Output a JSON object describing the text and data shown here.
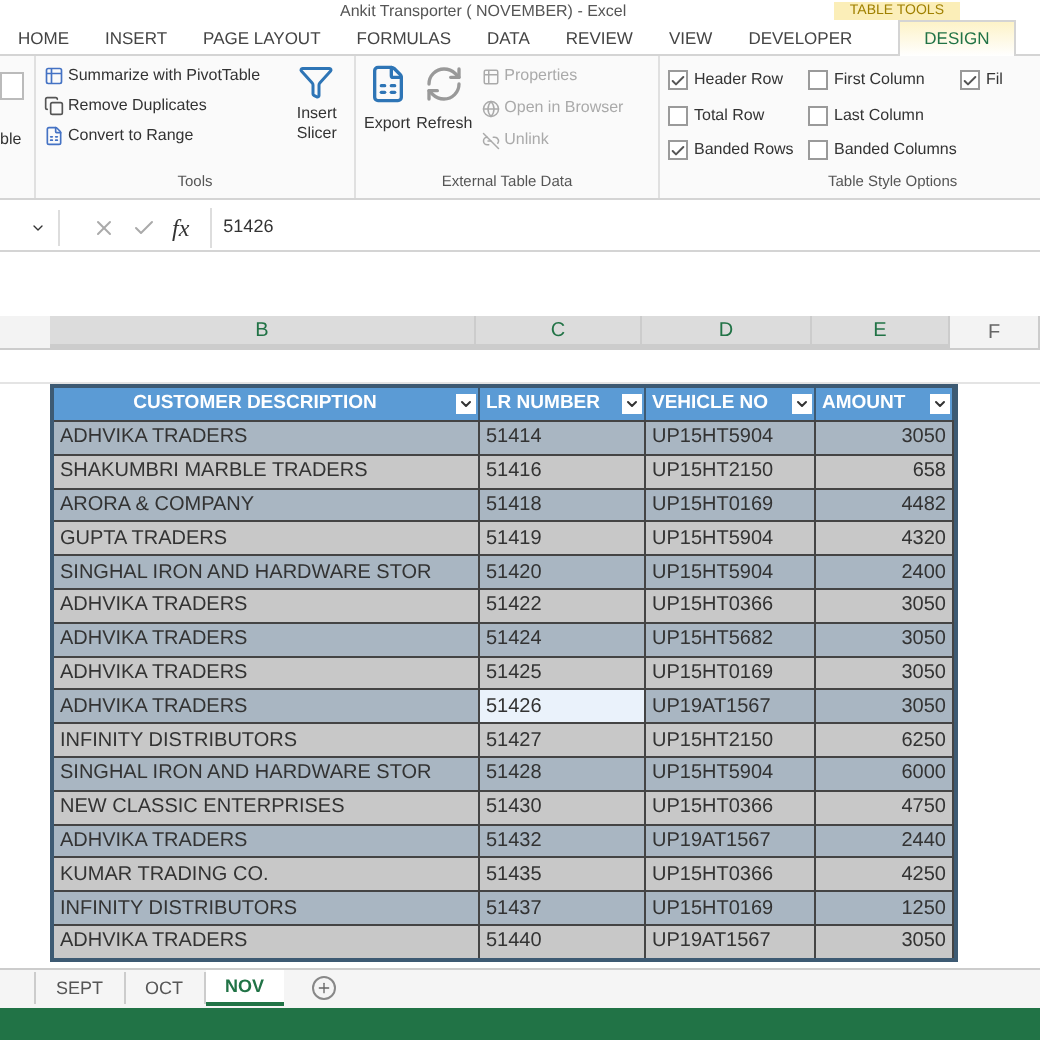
{
  "window": {
    "title": "Ankit Transporter ( NOVEMBER) - Excel",
    "context_tab": "TABLE TOOLS"
  },
  "ribbon_tabs": [
    {
      "label": "HOME",
      "selected": false
    },
    {
      "label": "INSERT",
      "selected": false
    },
    {
      "label": "PAGE LAYOUT",
      "selected": false
    },
    {
      "label": "FORMULAS",
      "selected": false
    },
    {
      "label": "DATA",
      "selected": false
    },
    {
      "label": "REVIEW",
      "selected": false
    },
    {
      "label": "VIEW",
      "selected": false
    },
    {
      "label": "DEVELOPER",
      "selected": false
    },
    {
      "label": "DESIGN",
      "selected": true
    }
  ],
  "properties_group": {
    "cut_label": "ble"
  },
  "tools_group": {
    "commands": [
      "Summarize with PivotTable",
      "Remove Duplicates",
      "Convert to Range"
    ],
    "slicer_button": "Insert Slicer",
    "label": "Tools"
  },
  "external_group": {
    "export": "Export",
    "refresh": "Refresh",
    "commands": [
      {
        "label": "Properties",
        "disabled": true
      },
      {
        "label": "Open in Browser",
        "disabled": true
      },
      {
        "label": "Unlink",
        "disabled": true
      }
    ],
    "label": "External Table Data"
  },
  "style_options": {
    "options": [
      {
        "label": "Header Row",
        "checked": true
      },
      {
        "label": "Total Row",
        "checked": false
      },
      {
        "label": "Banded Rows",
        "checked": true
      },
      {
        "label": "First Column",
        "checked": false
      },
      {
        "label": "Last Column",
        "checked": false
      },
      {
        "label": "Banded Columns",
        "checked": false
      },
      {
        "label": "Fil",
        "checked": true
      }
    ],
    "label": "Table Style Options"
  },
  "formula_bar": {
    "fx": "fx",
    "value": "51426"
  },
  "column_headers": [
    "B",
    "C",
    "D",
    "E",
    "F"
  ],
  "table": {
    "columns": [
      "CUSTOMER DESCRIPTION",
      "LR NUMBER",
      "VEHICLE NO",
      "AMOUNT"
    ],
    "rows": [
      {
        "cells": [
          "ADHVIKA TRADERS",
          "51414",
          "UP15HT5904",
          "3050"
        ],
        "selected": false
      },
      {
        "cells": [
          "SHAKUMBRI MARBLE TRADERS",
          "51416",
          "UP15HT2150",
          "658"
        ],
        "selected": false
      },
      {
        "cells": [
          "ARORA & COMPANY",
          "51418",
          "UP15HT0169",
          "4482"
        ],
        "selected": false
      },
      {
        "cells": [
          "GUPTA TRADERS",
          "51419",
          "UP15HT5904",
          "4320"
        ],
        "selected": false
      },
      {
        "cells": [
          "SINGHAL IRON AND HARDWARE STOR",
          "51420",
          "UP15HT5904",
          "2400"
        ],
        "selected": false
      },
      {
        "cells": [
          "ADHVIKA TRADERS",
          "51422",
          "UP15HT0366",
          "3050"
        ],
        "selected": false
      },
      {
        "cells": [
          "ADHVIKA TRADERS",
          "51424",
          "UP15HT5682",
          "3050"
        ],
        "selected": false
      },
      {
        "cells": [
          "ADHVIKA TRADERS",
          "51425",
          "UP15HT0169",
          "3050"
        ],
        "selected": false
      },
      {
        "cells": [
          "ADHVIKA TRADERS",
          "51426",
          "UP19AT1567",
          "3050"
        ],
        "selected": true
      },
      {
        "cells": [
          "INFINITY DISTRIBUTORS",
          "51427",
          "UP15HT2150",
          "6250"
        ],
        "selected": false
      },
      {
        "cells": [
          "SINGHAL IRON AND HARDWARE STOR",
          "51428",
          "UP15HT5904",
          "6000"
        ],
        "selected": false
      },
      {
        "cells": [
          "NEW CLASSIC ENTERPRISES",
          "51430",
          "UP15HT0366",
          "4750"
        ],
        "selected": false
      },
      {
        "cells": [
          "ADHVIKA TRADERS",
          "51432",
          "UP19AT1567",
          "2440"
        ],
        "selected": false
      },
      {
        "cells": [
          "KUMAR TRADING CO.",
          "51435",
          "UP15HT0366",
          "4250"
        ],
        "selected": false
      },
      {
        "cells": [
          "INFINITY DISTRIBUTORS",
          "51437",
          "UP15HT0169",
          "1250"
        ],
        "selected": false
      },
      {
        "cells": [
          "ADHVIKA TRADERS",
          "51440",
          "UP19AT1567",
          "3050"
        ],
        "selected": false
      }
    ]
  },
  "sheet_tabs": [
    {
      "label": "SEPT",
      "selected": false
    },
    {
      "label": "OCT",
      "selected": false
    },
    {
      "label": "NOV",
      "selected": true
    }
  ]
}
